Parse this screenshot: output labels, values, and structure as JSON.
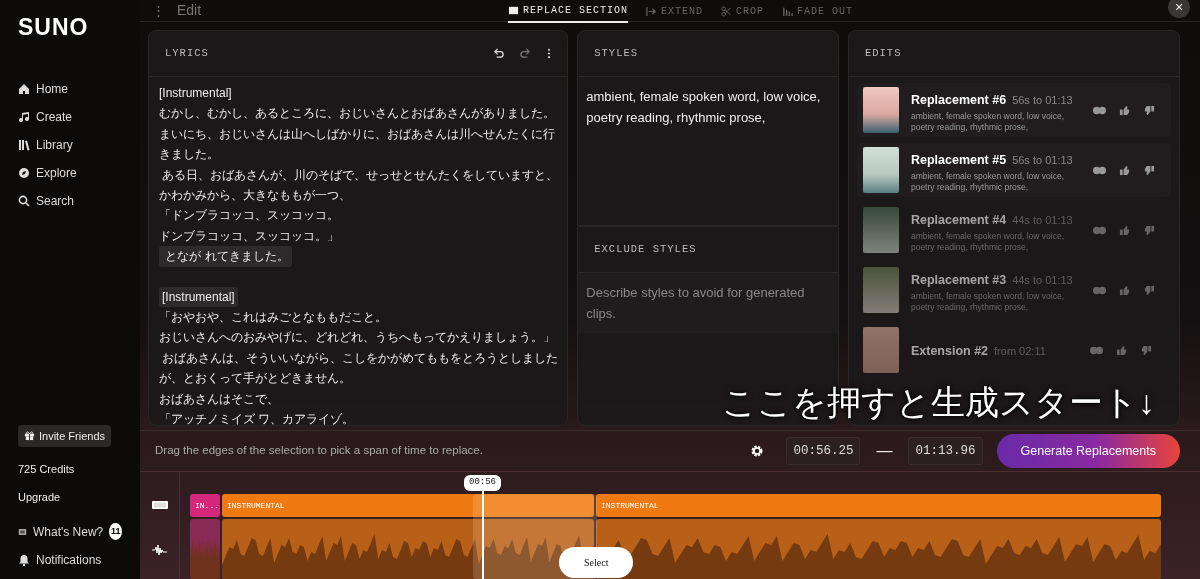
{
  "sidebar": {
    "logo": "SUNO",
    "nav": [
      {
        "label": "Home"
      },
      {
        "label": "Create"
      },
      {
        "label": "Library"
      },
      {
        "label": "Explore"
      },
      {
        "label": "Search"
      }
    ],
    "invite": "Invite Friends",
    "credits": "725 Credits",
    "upgrade": "Upgrade",
    "whats_new": "What's New?",
    "whats_new_badge": "11",
    "notifications": "Notifications"
  },
  "topbar": {
    "menu": "⋮",
    "title": "Edit",
    "tabs": [
      {
        "label": "REPLACE SECTION",
        "selected": true
      },
      {
        "label": "EXTEND",
        "selected": false
      },
      {
        "label": "CROP",
        "selected": false
      },
      {
        "label": "FADE OUT",
        "selected": false
      }
    ],
    "close": "×"
  },
  "lyrics": {
    "title": "LYRICS",
    "sections": [
      {
        "lines": [
          {
            "text": "[Instrumental]",
            "highlighted": false
          },
          {
            "text": "むかし、むかし、あるところに、おじいさんとおばあさんがありました。まいにち、おじいさんは山へしばかりに、おばあさんは川へせんたくに行きました。",
            "highlighted": false
          },
          {
            "text": " ある日、おばあさんが、川のそばで、せっせとせんたくをしていますと、かわかみから、大きなももが一つ、",
            "highlighted": false
          },
          {
            "text": "「ドンブラコッコ、スッコッコ。",
            "highlighted": false
          },
          {
            "text": "ドンブラコッコ、スッコッコ。」",
            "highlighted": false
          },
          {
            "text": " となが れてきました。",
            "highlighted": true
          }
        ]
      },
      {
        "lines": [
          {
            "text": "[Instrumental]",
            "highlighted": true
          },
          {
            "text": "「おやおや、これはみごとなももだこと。",
            "highlighted": false
          },
          {
            "text": "おじいさんへのおみやげに、どれどれ、うちへもってかえりましょう。」",
            "highlighted": false
          },
          {
            "text": " おばあさんは、そういいながら、こしをかがめてももをとろうとしましたが、とおくって手がとどきません。",
            "highlighted": false
          },
          {
            "text": "おばあさんはそこで、",
            "highlighted": false
          },
          {
            "text": "「アッチノミイズ ワ、カアライゾ。",
            "highlighted": false
          }
        ]
      }
    ]
  },
  "styles": {
    "title": "STYLES",
    "value": "ambient, female spoken word, low voice, poetry reading, rhythmic prose,",
    "exclude_title": "EXCLUDE STYLES",
    "exclude_placeholder": "Describe styles to avoid for generated clips."
  },
  "edits": {
    "title": "EDITS",
    "items": [
      {
        "title": "Replacement #6",
        "range": "56s to 01:13",
        "styles": "ambient, female spoken word, low voice, poetry reading, rhythmic prose,",
        "dimmed": false
      },
      {
        "title": "Replacement #5",
        "range": "56s to 01:13",
        "styles": "ambient, female spoken word, low voice, poetry reading, rhythmic prose,",
        "dimmed": false
      },
      {
        "title": "Replacement #4",
        "range": "44s to 01:13",
        "styles": "ambient, female spoken word, low voice, poetry reading, rhythmic prose,",
        "dimmed": true
      },
      {
        "title": "Replacement #3",
        "range": "44s to 01:13",
        "styles": "ambient, female spoken word, low voice, poetry reading, rhythmic prose,",
        "dimmed": true
      },
      {
        "title": "Extension #2",
        "range": "from 02:11",
        "dimmed": true
      }
    ]
  },
  "controls": {
    "hint": "Drag the edges of the selection to pick a span of time to replace.",
    "start": "00:56.25",
    "dash": "—",
    "end": "01:13.96",
    "generate": "Generate Replacements"
  },
  "timeline": {
    "playhead": "00:56",
    "sections": [
      {
        "label": "IN...",
        "kind": "intro"
      },
      {
        "label": "INSTRUMENTAL",
        "kind": "section"
      },
      {
        "label": "INSTRUMENTAL",
        "kind": "section"
      }
    ],
    "select": "Select"
  },
  "caption": "ここを押すと生成スタート↓"
}
